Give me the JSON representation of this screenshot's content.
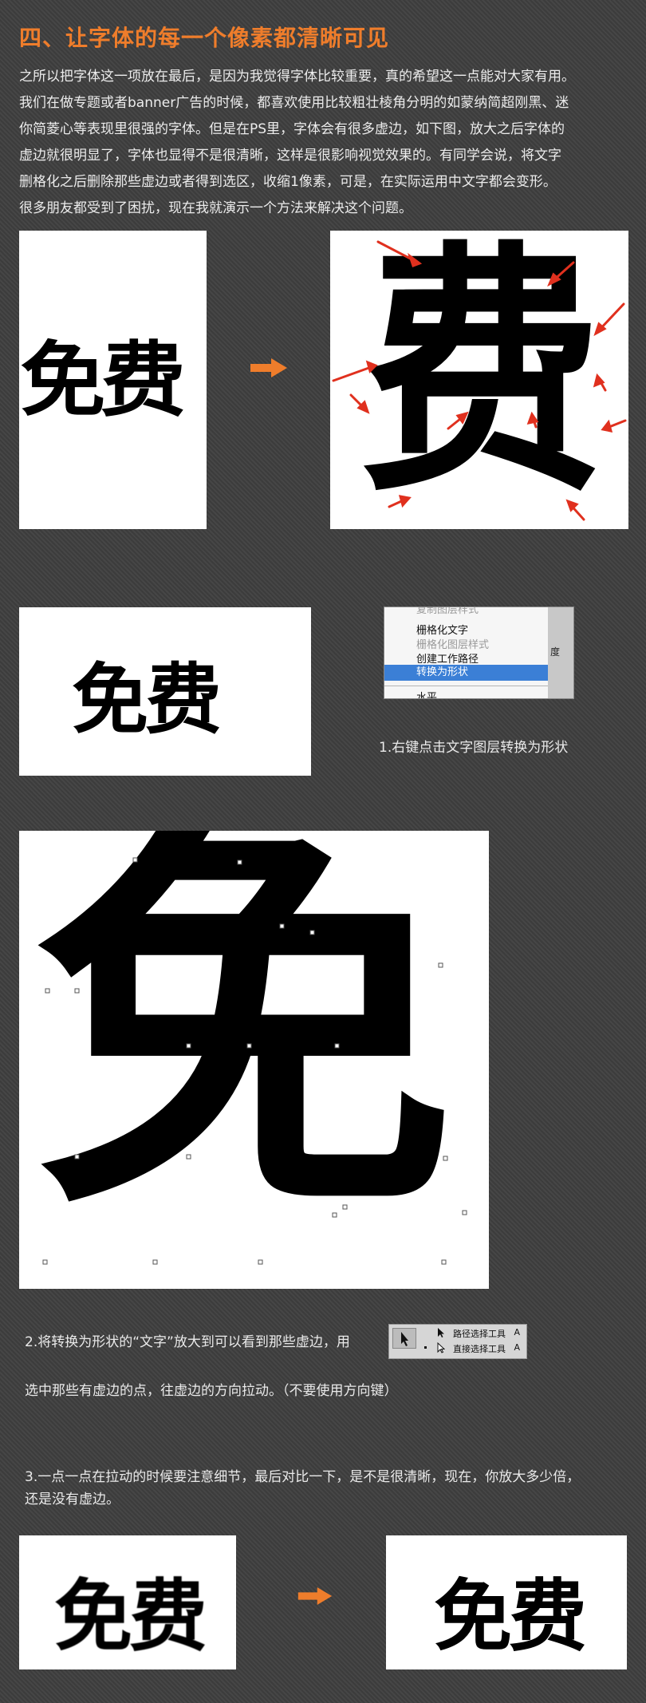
{
  "title": "四、让字体的每一个像素都清晰可见",
  "intro": {
    "lines": [
      "之所以把字体这一项放在最后，是因为我觉得字体比较重要，真的希望这一点能对大家有用。",
      "我们在做专题或者banner广告的时候，都喜欢使用比较粗壮棱角分明的如蒙纳简超刚黑、迷",
      "你简菱心等表现里很强的字体。但是在PS里，字体会有很多虚边，如下图，放大之后字体的",
      "虚边就很明显了，字体也显得不是很清晰，这样是很影响视觉效果的。有同学会说，将文字",
      "删格化之后删除那些虚边或者得到选区，收缩1像素，可是，在实际运用中文字都会变形。",
      "很多朋友都受到了困扰，现在我就演示一个方法来解决这个问题。"
    ]
  },
  "sample": {
    "word": "免费",
    "char_fei": "费",
    "char_mian": "免"
  },
  "context_menu": {
    "items": [
      "栅格化文字",
      "栅格化图层样式",
      "创建工作路径",
      "转换为形状",
      "水平"
    ],
    "partial_top": "复制图层样式",
    "partial_right": "度"
  },
  "step1": {
    "caption": "1.右键点击文字图层转换为形状"
  },
  "step2": {
    "caption_a": "2.将转换为形状的“文字”放大到可以看到那些虚边，用",
    "caption_b": "选中那些有虚边的点，往虚边的方向拉动。（不要使用方向键）"
  },
  "tool_panel": {
    "path_select": "路径选择工具",
    "direct_select": "直接选择工具",
    "shortcut": "A"
  },
  "step3": {
    "line1": "3.一点一点在拉动的时候要注意细节，最后对比一下，是不是很清晰，现在，你放大多少倍，",
    "line2": "还是没有虚边。"
  },
  "colors": {
    "accent": "#ef7d2b",
    "arrow_red": "#e0301e",
    "menu_highlight": "#3b7fd6"
  }
}
